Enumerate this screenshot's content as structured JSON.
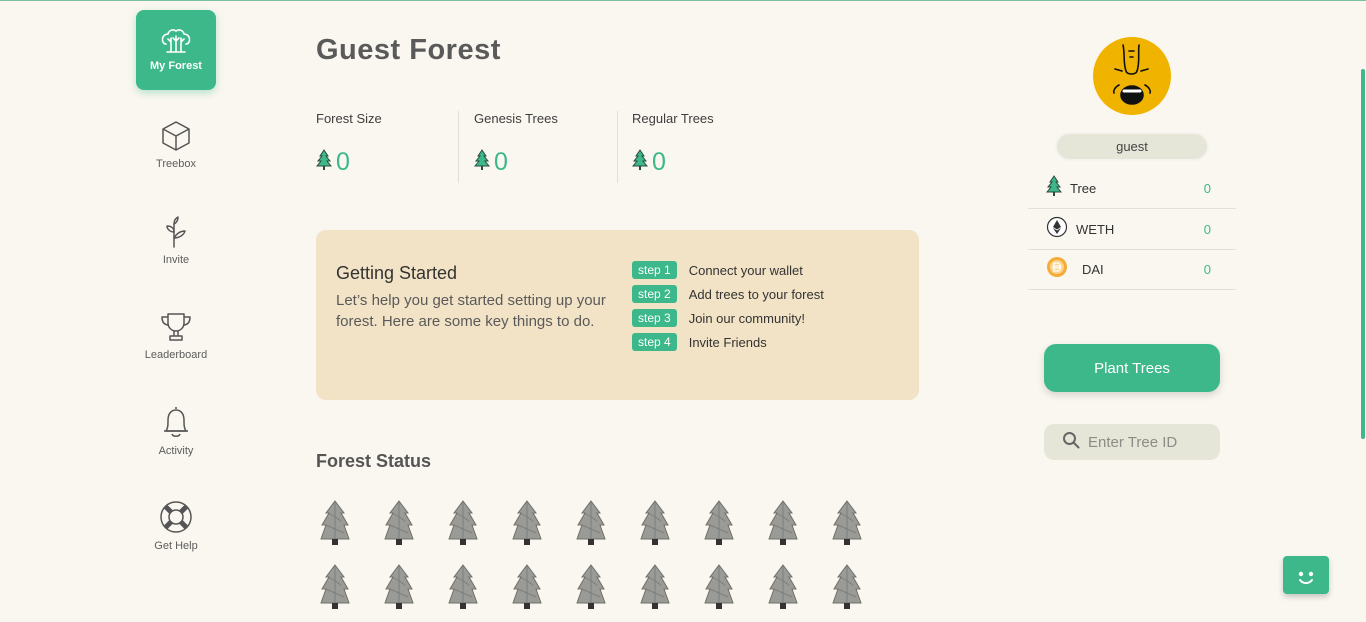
{
  "sidebar": {
    "items": [
      {
        "label": "My Forest",
        "icon": "forest-icon",
        "active": true
      },
      {
        "label": "Treebox",
        "icon": "box-icon"
      },
      {
        "label": "Invite",
        "icon": "sprout-icon"
      },
      {
        "label": "Leaderboard",
        "icon": "trophy-icon"
      },
      {
        "label": "Activity",
        "icon": "bell-icon"
      },
      {
        "label": "Get Help",
        "icon": "lifebuoy-icon"
      }
    ]
  },
  "main": {
    "title": "Guest Forest",
    "stats": [
      {
        "label": "Forest Size",
        "value": "0"
      },
      {
        "label": "Genesis Trees",
        "value": "0"
      },
      {
        "label": "Regular Trees",
        "value": "0"
      }
    ],
    "getting_started": {
      "title": "Getting Started",
      "description": "Let’s help you get started setting up your forest. Here are some key things to do.",
      "steps": [
        {
          "badge": "step 1",
          "text": "Connect your wallet"
        },
        {
          "badge": "step 2",
          "text": "Add trees to your forest"
        },
        {
          "badge": "step 3",
          "text": "Join our community!"
        },
        {
          "badge": "step 4",
          "text": "Invite Friends"
        }
      ]
    },
    "forest_status": {
      "title": "Forest Status",
      "placeholder_tree_count": 18
    }
  },
  "profile": {
    "username": "guest",
    "balances": [
      {
        "name": "Tree",
        "amount": "0",
        "icon": "tree-icon"
      },
      {
        "name": "WETH",
        "amount": "0",
        "icon": "ethereum-icon"
      },
      {
        "name": "DAI",
        "amount": "0",
        "icon": "dai-icon"
      }
    ],
    "plant_button": "Plant Trees",
    "search_placeholder": "Enter Tree ID"
  },
  "colors": {
    "accent": "#3cb88b",
    "background": "#faf7f0",
    "card": "#f2e3c6",
    "avatar": "#f0b400"
  }
}
